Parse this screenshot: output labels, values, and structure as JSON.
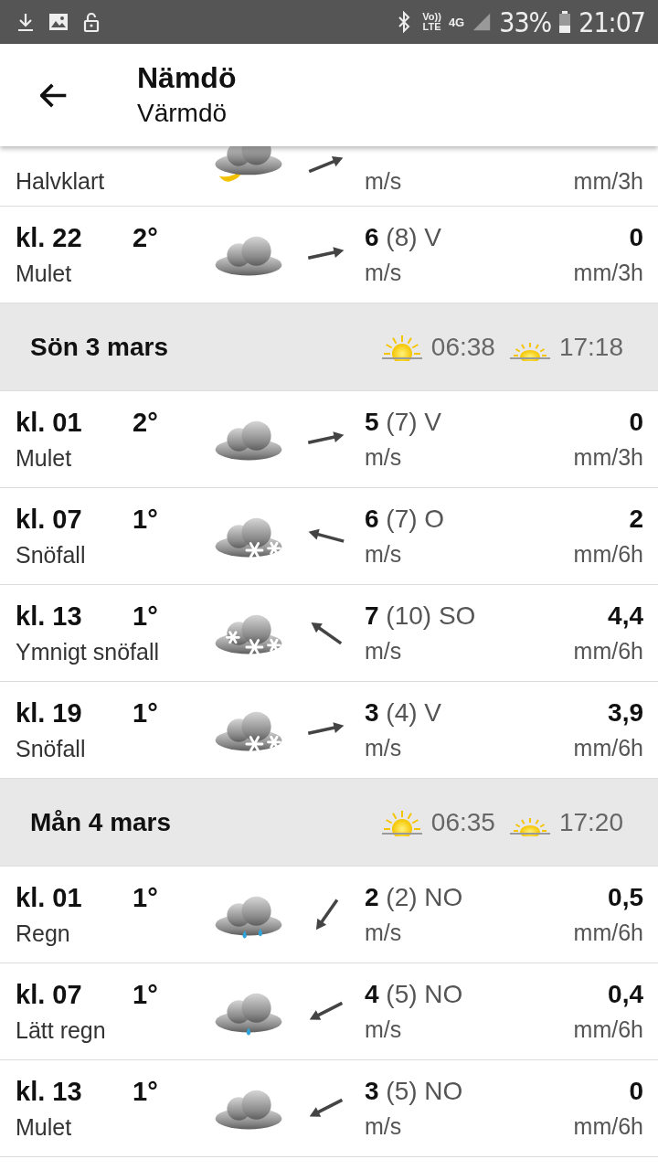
{
  "status_bar": {
    "volte_top": "Vo))",
    "volte_bottom": "LTE",
    "network": "4G",
    "battery": "33%",
    "time": "21:07"
  },
  "header": {
    "title": "Nämdö",
    "subtitle": "Värmdö"
  },
  "sections": [
    {
      "kind": "hours",
      "rows": [
        {
          "kind": "partly-cloudy-night",
          "description": "Halvklart",
          "wind_unit": "m/s",
          "precip_unit": "mm/3h"
        },
        {
          "kind": "cloud",
          "time": "kl. 22",
          "temp": "2°",
          "description": "Mulet",
          "wind": "6",
          "gust": "(8)",
          "direction": "V",
          "wind_unit": "m/s",
          "precip": "0",
          "precip_unit": "mm/3h"
        }
      ]
    },
    {
      "kind": "day",
      "day": "Sön 3 mars",
      "sunrise": "06:38",
      "sunset": "17:18",
      "rows": [
        {
          "kind": "cloud",
          "time": "kl. 01",
          "temp": "2°",
          "description": "Mulet",
          "wind": "5",
          "gust": "(7)",
          "direction": "V",
          "wind_unit": "m/s",
          "precip": "0",
          "precip_unit": "mm/3h"
        },
        {
          "kind": "snow",
          "time": "kl. 07",
          "temp": "1°",
          "description": "Snöfall",
          "wind": "6",
          "gust": "(7)",
          "direction": "O",
          "wind_unit": "m/s",
          "precip": "2",
          "precip_unit": "mm/6h"
        },
        {
          "kind": "heavy-snow",
          "time": "kl. 13",
          "temp": "1°",
          "description": "Ymnigt snöfall",
          "wind": "7",
          "gust": "(10)",
          "direction": "SO",
          "wind_unit": "m/s",
          "precip": "4,4",
          "precip_unit": "mm/6h"
        },
        {
          "kind": "snow",
          "time": "kl. 19",
          "temp": "1°",
          "description": "Snöfall",
          "wind": "3",
          "gust": "(4)",
          "direction": "V",
          "wind_unit": "m/s",
          "precip": "3,9",
          "precip_unit": "mm/6h"
        }
      ]
    },
    {
      "kind": "day",
      "day": "Mån 4 mars",
      "sunrise": "06:35",
      "sunset": "17:20",
      "rows": [
        {
          "kind": "rain",
          "time": "kl. 01",
          "temp": "1°",
          "description": "Regn",
          "wind": "2",
          "gust": "(2)",
          "direction": "NO",
          "wind_unit": "m/s",
          "precip": "0,5",
          "precip_unit": "mm/6h"
        },
        {
          "kind": "light-rain",
          "time": "kl. 07",
          "temp": "1°",
          "description": "Lätt regn",
          "wind": "4",
          "gust": "(5)",
          "direction": "NO",
          "wind_unit": "m/s",
          "precip": "0,4",
          "precip_unit": "mm/6h"
        },
        {
          "kind": "cloud",
          "time": "kl. 13",
          "temp": "1°",
          "description": "Mulet",
          "wind": "3",
          "gust": "(5)",
          "direction": "NO",
          "wind_unit": "m/s",
          "precip": "0",
          "precip_unit": "mm/6h"
        }
      ]
    }
  ]
}
